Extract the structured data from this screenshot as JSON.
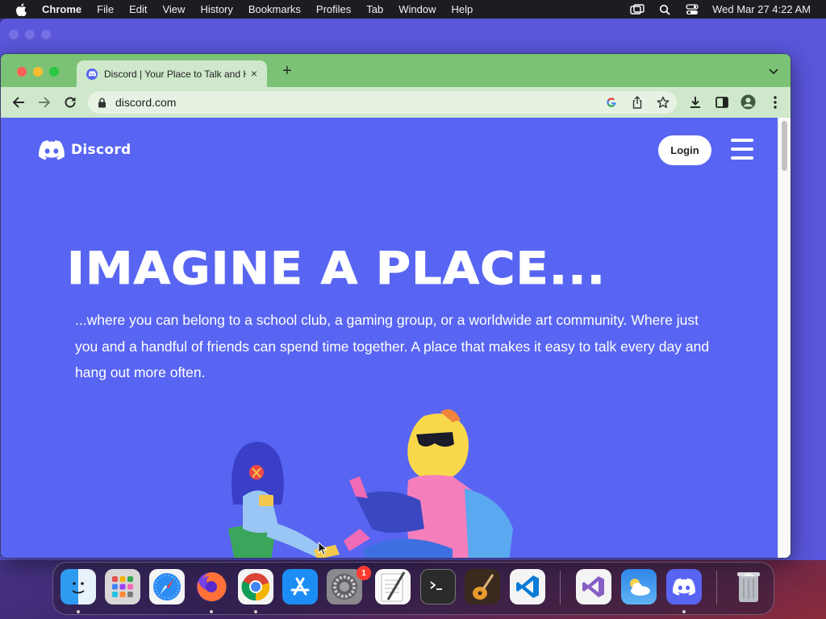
{
  "menubar": {
    "app_name": "Chrome",
    "items": [
      "File",
      "Edit",
      "View",
      "History",
      "Bookmarks",
      "Profiles",
      "Tab",
      "Window",
      "Help"
    ],
    "clock": "Wed Mar 27  4:22 AM"
  },
  "browser": {
    "tab_title": "Discord | Your Place to Talk and Hang Out",
    "tab_close": "×",
    "new_tab": "+",
    "url": "discord.com",
    "tabstrip_color": "#7cc276",
    "toolbar_color": "#cfe8cb"
  },
  "page": {
    "brand": "Discord",
    "login_label": "Login",
    "headline": "IMAGINE A PLACE...",
    "subtext": "...where you can belong to a school club, a gaming group, or a worldwide art community. Where just you and a handful of friends can spend time together. A place that makes it easy to talk every day and hang out more often.",
    "background_color": "#5865f2"
  },
  "dock": {
    "apps": [
      {
        "name": "Finder",
        "icon": "finder-icon",
        "running": true
      },
      {
        "name": "Launchpad",
        "icon": "launchpad-icon",
        "running": false
      },
      {
        "name": "Safari",
        "icon": "safari-icon",
        "running": false
      },
      {
        "name": "Firefox",
        "icon": "firefox-icon",
        "running": true
      },
      {
        "name": "Google Chrome",
        "icon": "chrome-icon",
        "running": true
      },
      {
        "name": "App Store",
        "icon": "app-store-icon",
        "running": false
      },
      {
        "name": "System Settings",
        "icon": "system-settings-icon",
        "running": false,
        "badge": "1"
      },
      {
        "name": "TextEdit",
        "icon": "textedit-icon",
        "running": false
      },
      {
        "name": "Terminal",
        "icon": "terminal-icon",
        "running": false
      },
      {
        "name": "GarageBand",
        "icon": "garageband-icon",
        "running": false
      },
      {
        "name": "Visual Studio Code",
        "icon": "vscode-icon",
        "running": false
      },
      {
        "name": "Visual Studio",
        "icon": "visual-studio-icon",
        "running": false
      },
      {
        "name": "Weather",
        "icon": "weather-icon",
        "running": false
      },
      {
        "name": "Discord",
        "icon": "discord-icon",
        "running": true
      },
      {
        "name": "Trash",
        "icon": "trash-icon",
        "running": false
      }
    ]
  }
}
